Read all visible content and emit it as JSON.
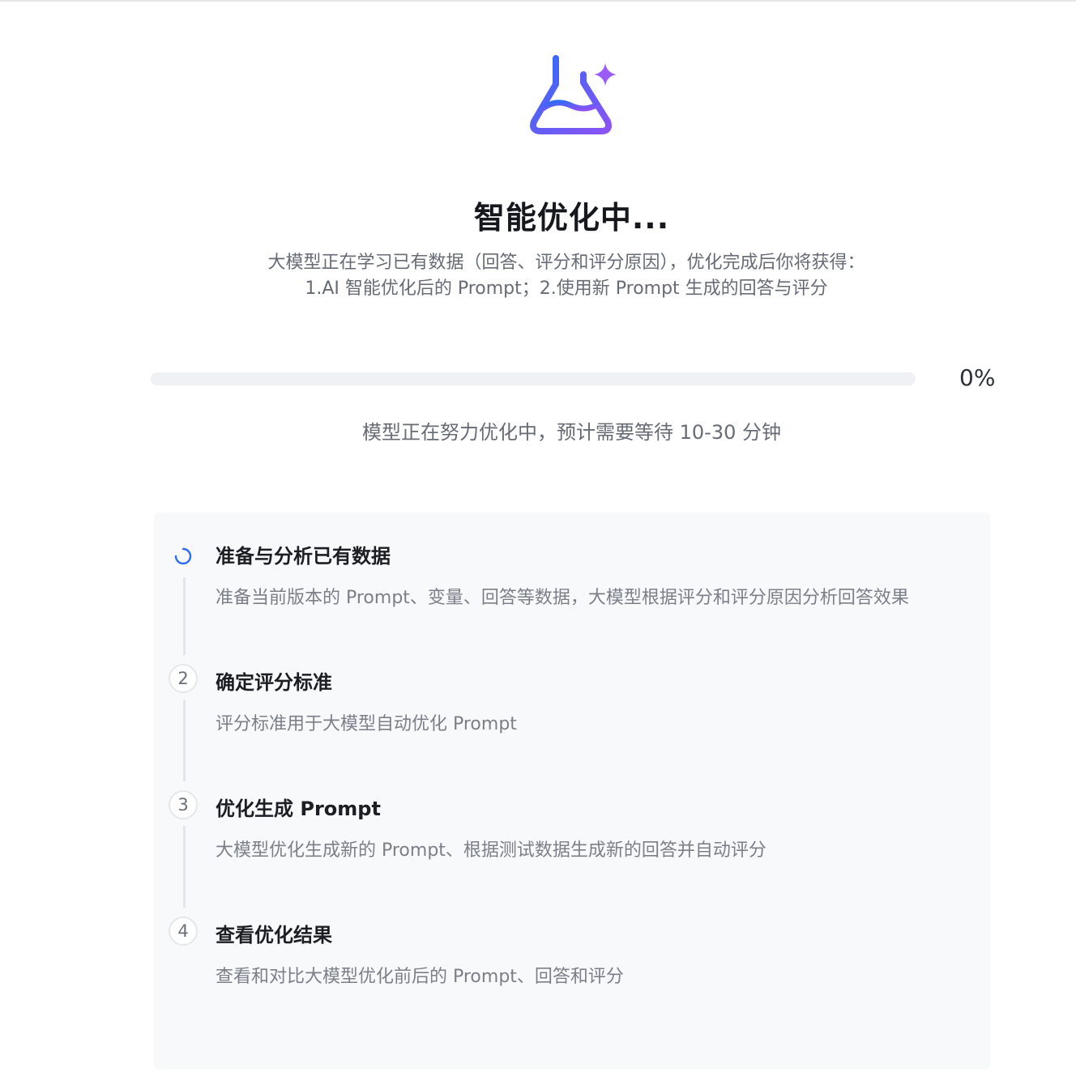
{
  "header": {
    "title": "智能优化中...",
    "description_line1": "大模型正在学习已有数据（回答、评分和评分原因），优化完成后你将获得：",
    "description_line2": "1.AI 智能优化后的 Prompt；2.使用新 Prompt 生成的回答与评分"
  },
  "progress": {
    "percent": 0,
    "label": "0%",
    "wait_text": "模型正在努力优化中，预计需要等待 10-30 分钟"
  },
  "steps": [
    {
      "indicator": "loading-spinner-icon",
      "title": "准备与分析已有数据",
      "desc": "准备当前版本的 Prompt、变量、回答等数据，大模型根据评分和评分原因分析回答效果"
    },
    {
      "indicator": "2",
      "title": "确定评分标准",
      "desc": "评分标准用于大模型自动优化 Prompt"
    },
    {
      "indicator": "3",
      "title": "优化生成 Prompt",
      "desc": "大模型优化生成新的 Prompt、根据测试数据生成新的回答并自动评分"
    },
    {
      "indicator": "4",
      "title": "查看优化结果",
      "desc": "查看和对比大模型优化前后的 Prompt、回答和评分"
    }
  ],
  "colors": {
    "accent_start": "#2f6cf6",
    "accent_end": "#8c52f5",
    "spinner": "#2f6cf6"
  },
  "icons": {
    "hero": "flask-sparkle-icon"
  }
}
